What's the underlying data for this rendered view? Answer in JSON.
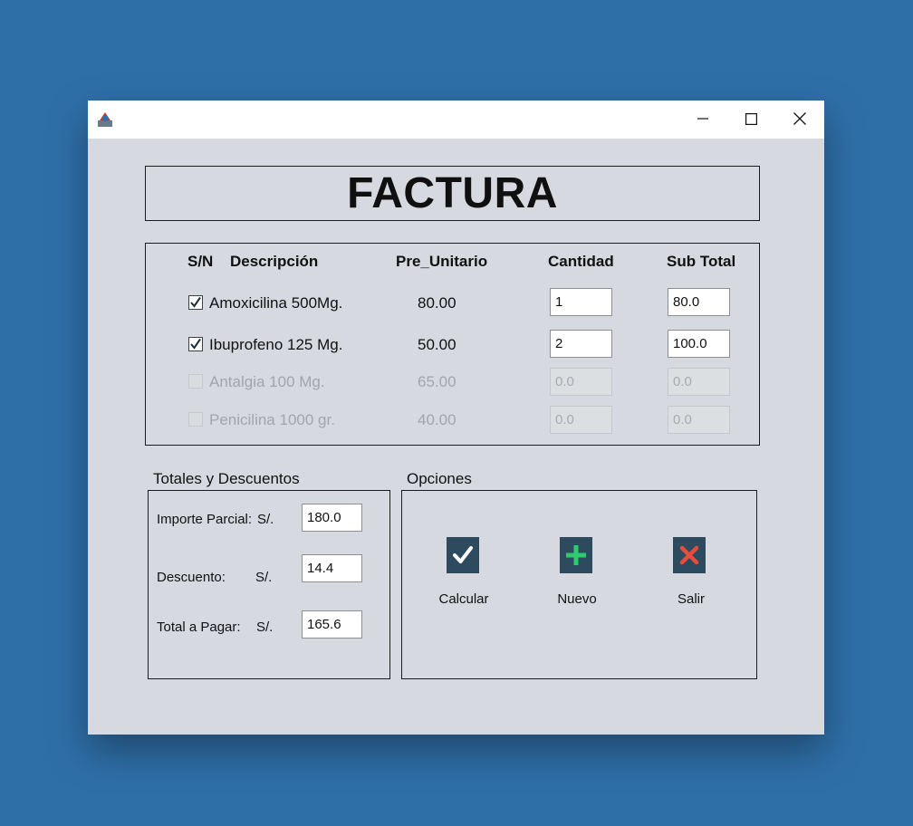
{
  "window": {
    "title": "",
    "controls": {
      "minimize": "minimize",
      "maximize": "maximize",
      "close": "close"
    }
  },
  "invoice": {
    "title": "FACTURA",
    "headers": [
      "S/N",
      "Descripción",
      "Pre_Unitario",
      "Cantidad",
      "Sub Total"
    ],
    "rows": [
      {
        "checked": true,
        "description": "Amoxicilina 500Mg.",
        "unit_price": "80.00",
        "quantity": "1",
        "subtotal": "80.0",
        "enabled": true
      },
      {
        "checked": true,
        "description": "Ibuprofeno 125 Mg.",
        "unit_price": "50.00",
        "quantity": "2",
        "subtotal": "100.0",
        "enabled": true
      },
      {
        "checked": false,
        "description": "Antalgia 100 Mg.",
        "unit_price": "65.00",
        "quantity": "0.0",
        "subtotal": "0.0",
        "enabled": false
      },
      {
        "checked": false,
        "description": "Penicilina 1000 gr.",
        "unit_price": "40.00",
        "quantity": "0.0",
        "subtotal": "0.0",
        "enabled": false
      }
    ]
  },
  "totals": {
    "section_title": "Totales y Descuentos",
    "currency": "S/.",
    "importe_label": "Importe Parcial:",
    "importe_value": "180.0",
    "descuento_label": "Descuento:",
    "descuento_value": "14.4",
    "total_label": "Total a Pagar:",
    "total_value": "165.6"
  },
  "options": {
    "section_title": "Opciones",
    "calcular_label": "Calcular",
    "nuevo_label": "Nuevo",
    "salir_label": "Salir"
  },
  "colors": {
    "desktop": "#2f6fa8",
    "panel": "#d6d9df",
    "icon_bg": "#2e4a5e",
    "check_icon": "#ffffff",
    "plus_icon": "#2ecc71",
    "x_icon": "#e74c3c"
  }
}
